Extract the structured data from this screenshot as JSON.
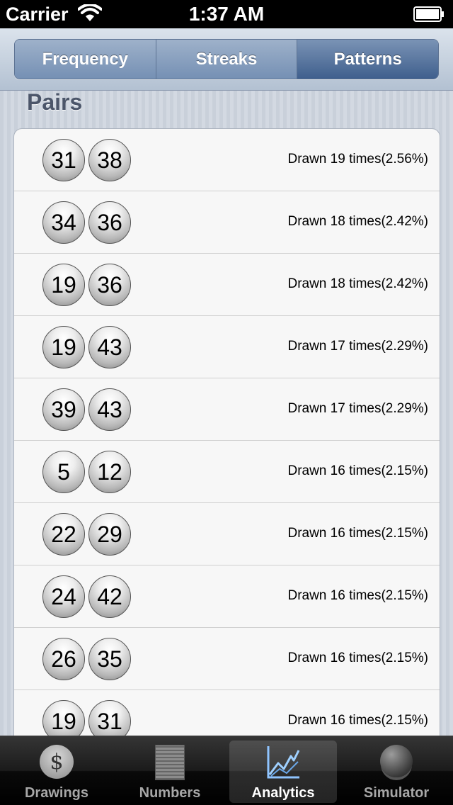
{
  "status_bar": {
    "carrier": "Carrier",
    "time": "1:37 AM"
  },
  "segmented_control": {
    "segments": [
      "Frequency",
      "Streaks",
      "Patterns"
    ],
    "selected": "Patterns"
  },
  "section_title": "Pairs",
  "pairs": [
    {
      "n1": "31",
      "n2": "38",
      "stat": "Drawn 19 times(2.56%)"
    },
    {
      "n1": "34",
      "n2": "36",
      "stat": "Drawn 18 times(2.42%)"
    },
    {
      "n1": "19",
      "n2": "36",
      "stat": "Drawn 18 times(2.42%)"
    },
    {
      "n1": "19",
      "n2": "43",
      "stat": "Drawn 17 times(2.29%)"
    },
    {
      "n1": "39",
      "n2": "43",
      "stat": "Drawn 17 times(2.29%)"
    },
    {
      "n1": "5",
      "n2": "12",
      "stat": "Drawn 16 times(2.15%)"
    },
    {
      "n1": "22",
      "n2": "29",
      "stat": "Drawn 16 times(2.15%)"
    },
    {
      "n1": "24",
      "n2": "42",
      "stat": "Drawn 16 times(2.15%)"
    },
    {
      "n1": "26",
      "n2": "35",
      "stat": "Drawn 16 times(2.15%)"
    },
    {
      "n1": "19",
      "n2": "31",
      "stat": "Drawn 16 times(2.15%)"
    }
  ],
  "tab_bar": {
    "tabs": [
      {
        "label": "Drawings",
        "icon": "dollar-icon"
      },
      {
        "label": "Numbers",
        "icon": "number-grid-icon"
      },
      {
        "label": "Analytics",
        "icon": "line-chart-icon"
      },
      {
        "label": "Simulator",
        "icon": "crystal-ball-icon"
      }
    ],
    "selected": "Analytics"
  },
  "colors": {
    "segment_selected": "#3f5f8d",
    "segment_normal": "#7590b4",
    "title_text": "#4c566a"
  }
}
